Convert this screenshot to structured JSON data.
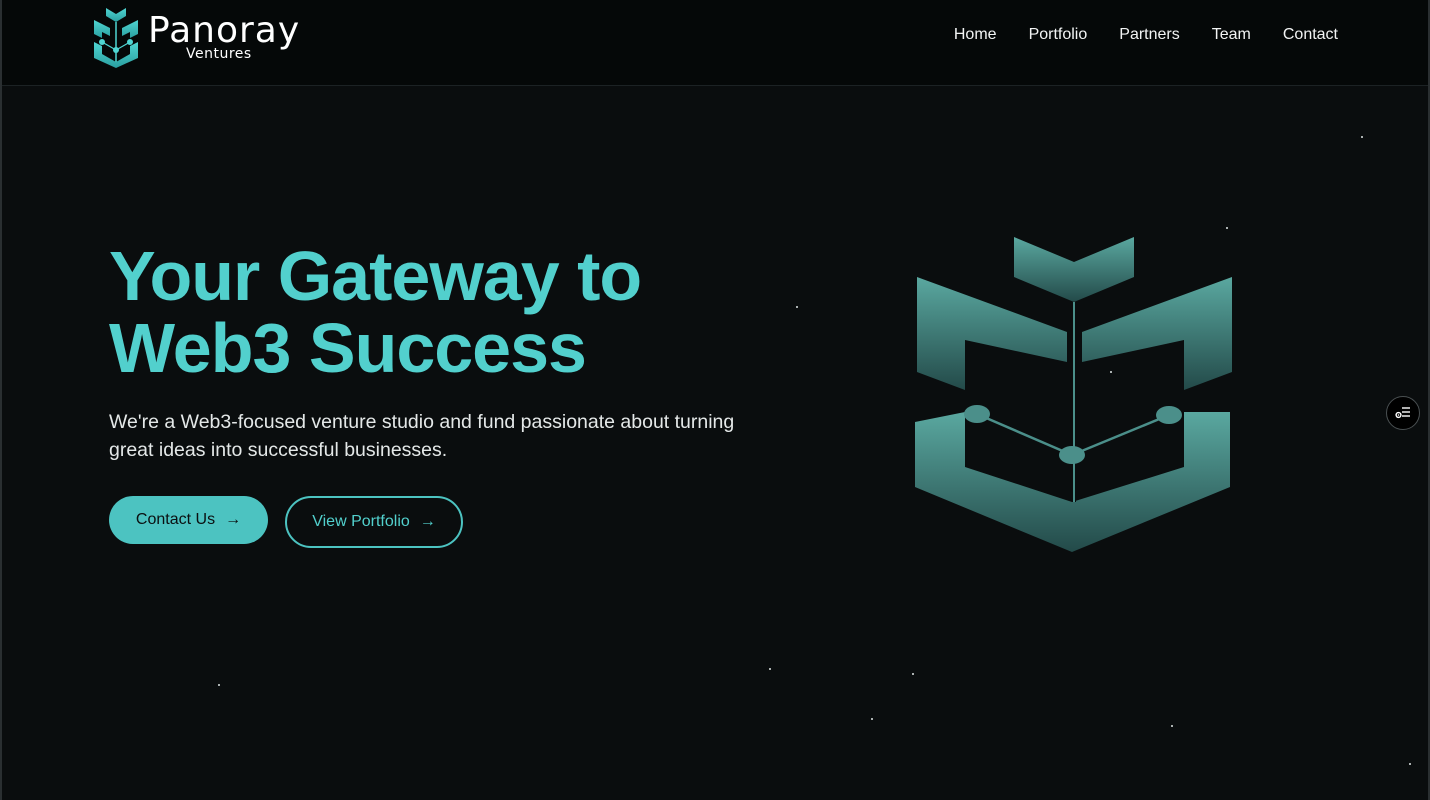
{
  "brand": {
    "name": "Panoray",
    "subtitle": "Ventures",
    "accent_color": "#4cc3c1"
  },
  "nav": {
    "items": [
      {
        "label": "Home"
      },
      {
        "label": "Portfolio"
      },
      {
        "label": "Partners"
      },
      {
        "label": "Team"
      },
      {
        "label": "Contact"
      }
    ]
  },
  "hero": {
    "title_line1": "Your Gateway to",
    "title_line2": "Web3 Success",
    "description_line1": "We're a Web3-focused venture studio and fund passionate about turning",
    "description_line2": "great ideas into successful businesses.",
    "primary_button": {
      "label": "Contact Us",
      "icon": "arrow-right-icon"
    },
    "secondary_button": {
      "label": "View Portfolio",
      "icon": "arrow-right-icon"
    }
  },
  "emblem": {
    "icon": "panoray-emblem-icon"
  },
  "side_widget": {
    "icon": "settings-list-icon"
  }
}
